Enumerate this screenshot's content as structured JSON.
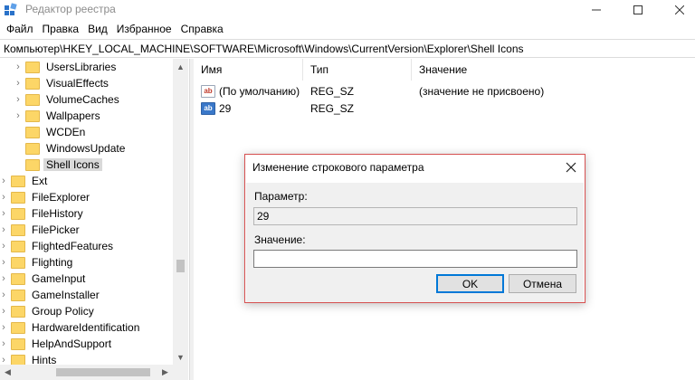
{
  "window": {
    "title": "Редактор реестра",
    "controls": {
      "minimize": "—",
      "maximize": "☐",
      "close": "✕"
    }
  },
  "menu": [
    "Файл",
    "Правка",
    "Вид",
    "Избранное",
    "Справка"
  ],
  "address": "Компьютер\\HKEY_LOCAL_MACHINE\\SOFTWARE\\Microsoft\\Windows\\CurrentVersion\\Explorer\\Shell Icons",
  "tree": {
    "items": [
      {
        "label": "UsersLibraries",
        "expandable": true,
        "selected": false,
        "level": 2
      },
      {
        "label": "VisualEffects",
        "expandable": true,
        "selected": false,
        "level": 2
      },
      {
        "label": "VolumeCaches",
        "expandable": true,
        "selected": false,
        "level": 2
      },
      {
        "label": "Wallpapers",
        "expandable": true,
        "selected": false,
        "level": 2
      },
      {
        "label": "WCDEn",
        "expandable": false,
        "selected": false,
        "level": 2
      },
      {
        "label": "WindowsUpdate",
        "expandable": false,
        "selected": false,
        "level": 2
      },
      {
        "label": "Shell Icons",
        "expandable": false,
        "selected": true,
        "level": 2
      },
      {
        "label": "Ext",
        "expandable": true,
        "selected": false,
        "level": 1
      },
      {
        "label": "FileExplorer",
        "expandable": true,
        "selected": false,
        "level": 1
      },
      {
        "label": "FileHistory",
        "expandable": true,
        "selected": false,
        "level": 1
      },
      {
        "label": "FilePicker",
        "expandable": true,
        "selected": false,
        "level": 1
      },
      {
        "label": "FlightedFeatures",
        "expandable": true,
        "selected": false,
        "level": 1
      },
      {
        "label": "Flighting",
        "expandable": true,
        "selected": false,
        "level": 1
      },
      {
        "label": "GameInput",
        "expandable": true,
        "selected": false,
        "level": 1
      },
      {
        "label": "GameInstaller",
        "expandable": true,
        "selected": false,
        "level": 1
      },
      {
        "label": "Group Policy",
        "expandable": true,
        "selected": false,
        "level": 1
      },
      {
        "label": "HardwareIdentification",
        "expandable": true,
        "selected": false,
        "level": 1
      },
      {
        "label": "HelpAndSupport",
        "expandable": true,
        "selected": false,
        "level": 1
      },
      {
        "label": "Hints",
        "expandable": true,
        "selected": false,
        "level": 1
      }
    ]
  },
  "list": {
    "columns": [
      "Имя",
      "Тип",
      "Значение"
    ],
    "rows": [
      {
        "name": "(По умолчанию)",
        "type": "REG_SZ",
        "value": "(значение не присвоено)",
        "icon": "string-value-icon-default"
      },
      {
        "name": "29",
        "type": "REG_SZ",
        "value": "",
        "icon": "string-value-icon"
      }
    ]
  },
  "dialog": {
    "title": "Изменение строкового параметра",
    "param_label": "Параметр:",
    "param_value": "29",
    "value_label": "Значение:",
    "value_value": "",
    "ok_label": "OK",
    "cancel_label": "Отмена",
    "close_glyph": "✕"
  },
  "colors": {
    "folder": "#fcd667",
    "dialog_border": "#d65050",
    "accent": "#0078d7",
    "selection": "#d9d9d9"
  }
}
